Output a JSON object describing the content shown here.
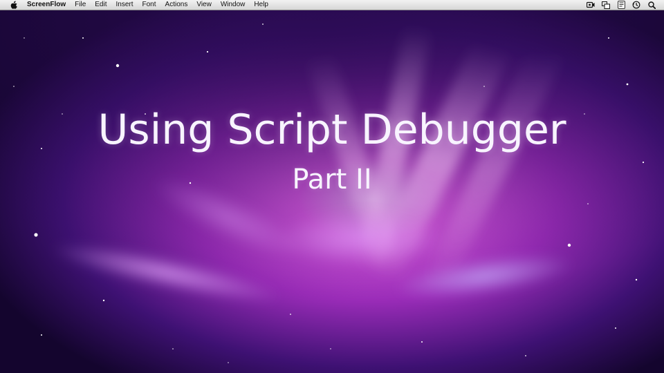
{
  "menubar": {
    "app_name": "ScreenFlow",
    "items": [
      "File",
      "Edit",
      "Insert",
      "Font",
      "Actions",
      "View",
      "Window",
      "Help"
    ],
    "status_icons": [
      "screen-recorder-icon",
      "window-switch-icon",
      "script-menu-icon",
      "time-machine-icon",
      "spotlight-search-icon"
    ]
  },
  "slide": {
    "title": "Using Script Debugger",
    "subtitle": "Part II"
  },
  "colors": {
    "menubar_bg": "#e4e4e4",
    "wallpaper_dark": "#14052e",
    "wallpaper_magenta": "#d23ad6",
    "text": "#f8f4ff"
  }
}
